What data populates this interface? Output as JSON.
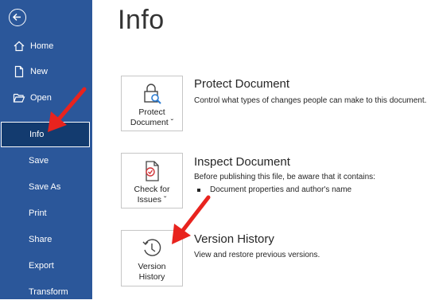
{
  "sidebar": {
    "items": [
      {
        "label": "Home"
      },
      {
        "label": "New"
      },
      {
        "label": "Open"
      },
      {
        "label": "Info"
      },
      {
        "label": "Save"
      },
      {
        "label": "Save As"
      },
      {
        "label": "Print"
      },
      {
        "label": "Share"
      },
      {
        "label": "Export"
      },
      {
        "label": "Transform"
      }
    ]
  },
  "main": {
    "title": "Info",
    "sections": [
      {
        "tile_line1": "Protect",
        "tile_line2": "Document ˇ",
        "title": "Protect Document",
        "description": "Control what types of changes people can make to this document."
      },
      {
        "tile_line1": "Check for",
        "tile_line2": "Issues ˇ",
        "title": "Inspect Document",
        "description": "Before publishing this file, be aware that it contains:",
        "bullets": [
          "Document properties and author's name"
        ]
      },
      {
        "tile_line1": "Version",
        "tile_line2": "History",
        "title": "Version History",
        "description": "View and restore previous versions."
      }
    ]
  },
  "colors": {
    "sidebar": "#2b579a",
    "active_item": "#133b6f",
    "annotation_arrow": "#e8231e"
  }
}
